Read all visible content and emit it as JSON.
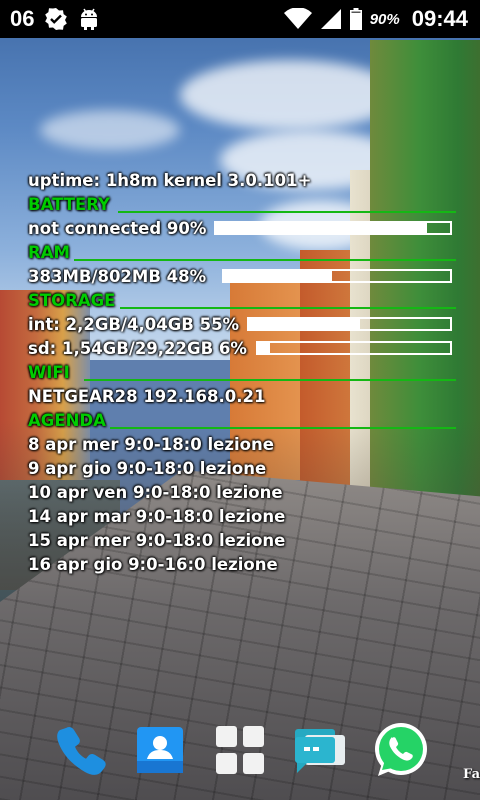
{
  "status_bar": {
    "notification_count": "06",
    "icons": [
      "checkmark-badge-icon",
      "android-icon",
      "wifi-icon",
      "signal-icon",
      "battery-icon"
    ],
    "battery_percent": "90%",
    "time": "09:44"
  },
  "widget": {
    "uptime": "uptime: 1h8m kernel 3.0.101+",
    "battery": {
      "heading": "BATTERY",
      "status": "not connected 90%",
      "level": 0.9
    },
    "ram": {
      "heading": "RAM",
      "usage": "383MB/802MB 48%",
      "level": 0.48
    },
    "storage": {
      "heading": "STORAGE",
      "internal": "int: 2,2GB/4,04GB 55%",
      "internal_level": 0.55,
      "sd": "sd: 1,54GB/29,22GB 6%",
      "sd_level": 0.06
    },
    "wifi": {
      "heading": "WIFI",
      "network": "NETGEAR28 192.168.0.21"
    },
    "agenda": {
      "heading": "AGENDA",
      "items": [
        "8 apr mer 9:0-18:0 lezione",
        "9 apr gio 9:0-18:0 lezione",
        "10 apr ven 9:0-18:0 lezione",
        "14 apr mar 9:0-18:0 lezione",
        "15 apr mer 9:0-18:0 lezione",
        "16 apr gio 9:0-16:0 lezione"
      ]
    }
  },
  "dock": {
    "apps": [
      "phone-icon",
      "contacts-icon",
      "app-drawer-icon",
      "messaging-icon",
      "whatsapp-icon"
    ],
    "corner_text": "Fa"
  },
  "colors": {
    "section_heading": "#00cc00",
    "section_line": "#14b814",
    "text": "#ffffff",
    "status_bar": "#000000"
  }
}
